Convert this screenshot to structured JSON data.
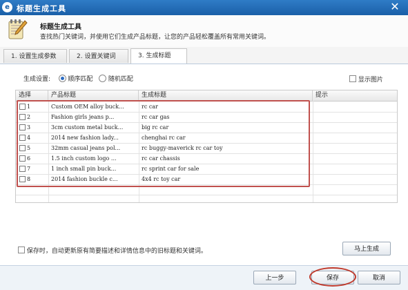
{
  "window": {
    "title": "标题生成工具",
    "close_glyph": "✕"
  },
  "header": {
    "heading": "标题生成工具",
    "description": "查找热门关键词，并使用它们生成产品标题，让您的产品轻松覆盖所有常用关键词。"
  },
  "tabs": [
    {
      "label": "1. 设置生成参数",
      "active": false
    },
    {
      "label": "2. 设置关键词",
      "active": false
    },
    {
      "label": "3. 生成标题",
      "active": true
    }
  ],
  "options": {
    "label": "生成设置:",
    "radio_sequential": "顺序匹配",
    "radio_random": "随机匹配",
    "selected": "顺序匹配",
    "show_image_label": "显示图片"
  },
  "table": {
    "columns": [
      "选择",
      "产品标题",
      "生成标题",
      "提示"
    ],
    "rows": [
      {
        "num": "1",
        "product": "Custom OEM alloy buck...",
        "generated": "rc car"
      },
      {
        "num": "2",
        "product": "Fashion girls jeans p...",
        "generated": "rc car gas"
      },
      {
        "num": "3",
        "product": "3cm custom metal buck...",
        "generated": "big rc car"
      },
      {
        "num": "4",
        "product": "2014 new fashion lady...",
        "generated": "chenghai rc car"
      },
      {
        "num": "5",
        "product": "32mm casual jeans pol...",
        "generated": "rc buggy-maverick rc car toy"
      },
      {
        "num": "6",
        "product": "1.5 inch custom logo ...",
        "generated": "rc car chassis"
      },
      {
        "num": "7",
        "product": "1 inch small pin buck...",
        "generated": "rc sprint car for sale"
      },
      {
        "num": "8",
        "product": "2014 fashion buckle c...",
        "generated": "4x4 rc toy car"
      }
    ]
  },
  "footer": {
    "save_option_label": "保存时，自动更新原有简要描述和详情信息中的旧标题和关键词。",
    "generate_now": "马上生成",
    "prev": "上一步",
    "save": "保存",
    "cancel": "取消"
  },
  "colors": {
    "titlebar": "#1a5fa8",
    "highlight_red": "#c0504d",
    "accent_blue": "#2a6bc2"
  }
}
